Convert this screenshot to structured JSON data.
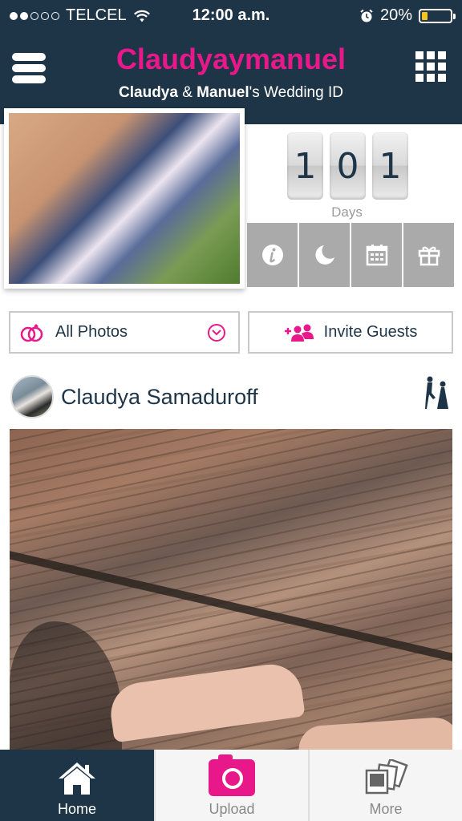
{
  "status_bar": {
    "carrier": "TELCEL",
    "time": "12:00 a.m.",
    "battery_percent": "20%",
    "battery_level": 0.2,
    "signal_bars_filled": 2,
    "signal_bars_total": 5
  },
  "header": {
    "title": "Claudyaymanuel",
    "subtitle_name1": "Claudya",
    "subtitle_amp": " & ",
    "subtitle_name2": "Manuel",
    "subtitle_rest": "'s Wedding ID",
    "title_color": "#e8188b",
    "bar_color": "#1e3548"
  },
  "countdown": {
    "digits": [
      "1",
      "0",
      "1"
    ],
    "label": "Days"
  },
  "quick_actions": [
    {
      "icon": "info-icon"
    },
    {
      "icon": "moon-icon"
    },
    {
      "icon": "calendar-icon"
    },
    {
      "icon": "gift-icon"
    }
  ],
  "filters": {
    "all_photos_label": "All Photos",
    "invite_label": "Invite Guests"
  },
  "post": {
    "user_name": "Claudya Samaduroff"
  },
  "tabbar": {
    "home_label": "Home",
    "upload_label": "Upload",
    "more_label": "More",
    "active": "Home"
  }
}
